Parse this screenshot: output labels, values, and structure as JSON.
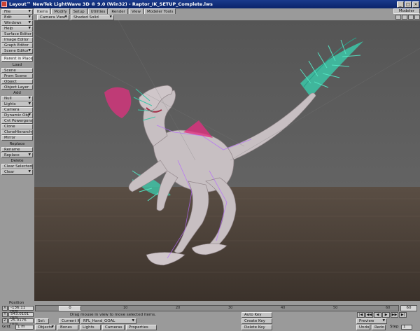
{
  "window": {
    "title": "Layout™ NewTek LightWave 3D ® 9.0 (Win32) - Raptor_IK_SETUP_Complete.lws"
  },
  "left_panel": {
    "top_menus": [
      "File",
      "Edit",
      "Windows",
      "Help",
      "Surface Editor",
      "Image Editor",
      "Graph Editor",
      "Scene Editor"
    ],
    "parent_in_place": "Parent in Place",
    "load_title": "Load",
    "load_items": [
      "Scene",
      "From Scene",
      "Object",
      "Object Layer"
    ],
    "add_title": "Add",
    "add_items": [
      "Null",
      "Lights",
      "Camera",
      "Dynamic Obj",
      "Cvt Powergons",
      "Clone",
      "CloneHierarchy",
      "Mirror"
    ],
    "replace_title": "Replace",
    "replace_items": [
      "Rename",
      "Replace"
    ],
    "delete_title": "Delete",
    "delete_items": [
      "Clear Selected",
      "Clear"
    ]
  },
  "tabs": [
    "Items",
    "Modify",
    "Setup",
    "Utilities",
    "Render",
    "View",
    "Modeler Tools"
  ],
  "modeler_button": "Modeler",
  "viewbar": {
    "view_mode": "Camera View",
    "shading": "Shaded Solid"
  },
  "bottom": {
    "position_label": "Position",
    "x_value": "-136.11 mm",
    "y_value": "543.0101 mm",
    "z_value": "25.0176 mm",
    "grid_label": "Grid:",
    "grid_value": "1 m",
    "current_frame": "0",
    "timeline_ticks": [
      "0",
      "10",
      "20",
      "30",
      "40",
      "50",
      "60"
    ],
    "end_frame": "60",
    "status_message": "Drag mouse in view to move selected items.",
    "sel_label": "Sel:",
    "current_item_label": "Current Item",
    "current_item_value": "RFL_Hand_GOAL",
    "objects_label": "Objects",
    "bones_label": "Bones",
    "lights_label": "Lights",
    "cameras_label": "Cameras",
    "properties_label": "Properties",
    "auto_key": "Auto Key",
    "create_key": "Create Key",
    "delete_key": "Delete Key",
    "preview": "Preview",
    "undo": "Undo",
    "redo": "Redo",
    "step_label": "Step",
    "step_value": "1"
  },
  "colors": {
    "background_panel": "#9a9a9a",
    "viewport": "#5b5b5b",
    "ground": "#4a3f36",
    "model": "#c7bfc2",
    "feathers": "#3cc7a8",
    "bones_pink": "#e0307f"
  }
}
